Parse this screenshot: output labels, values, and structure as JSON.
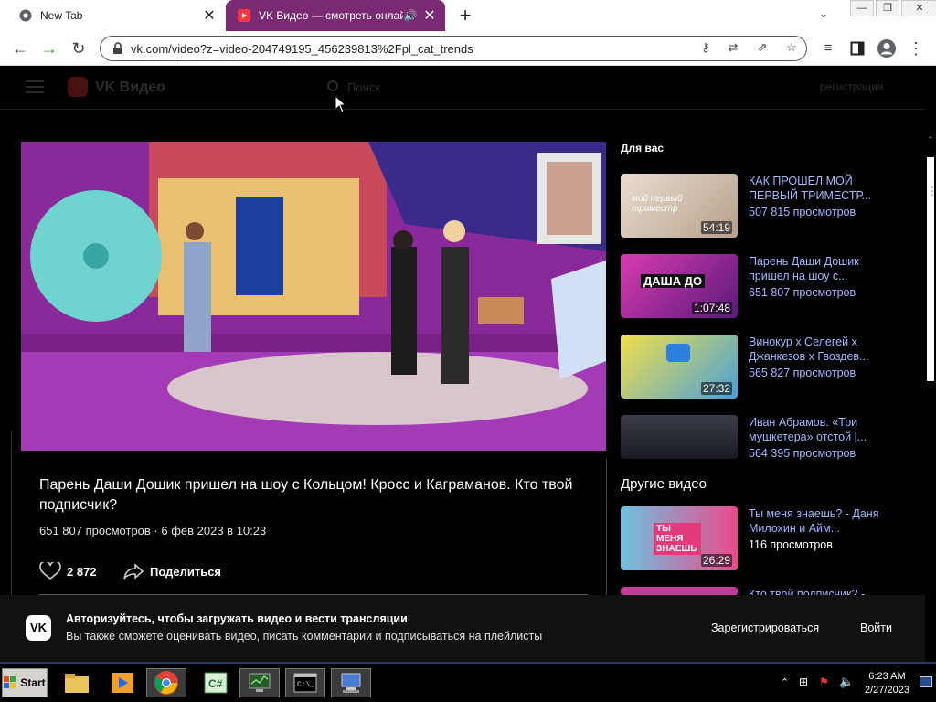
{
  "browser": {
    "tabs": [
      {
        "title": "New Tab",
        "active": false
      },
      {
        "title": "VK Видео — смотреть онлайн",
        "active": true
      }
    ],
    "url": "vk.com/video?z=video-204749195_456239813%2Fpl_cat_trends"
  },
  "header": {
    "brand": "VK Видео",
    "search_placeholder": "Поиск",
    "register": "регистрация"
  },
  "video": {
    "title": "Парень Даши Дошик пришел на шоу с Кольцом! Кросс и Каграманов. Кто твой подписчик?",
    "meta": "651 807 просмотров · 6 фев 2023 в 10:23",
    "likes": "2 872",
    "share_label": "Поделиться"
  },
  "sidebar": {
    "for_you_heading": "Для вас",
    "other_heading": "Другие видео",
    "cards": [
      {
        "title": "КАК ПРОШЕЛ МОЙ ПЕРВЫЙ ТРИМЕСТР...",
        "views": "507 815 просмотров",
        "duration": "54:19",
        "thumb_caption": "мой первый триместр"
      },
      {
        "title": "Парень Даши Дошик пришел на шоу с...",
        "views": "651 807 просмотров",
        "duration": "1:07:48",
        "thumb_caption": "ДАША ДО"
      },
      {
        "title": "Винокур x Селегей x Джанкезов x Гвоздев...",
        "views": "565 827 просмотров",
        "duration": "27:32",
        "thumb_caption": ""
      },
      {
        "title": "Иван Абрамов. «Три мушкетера» отстой |...",
        "views": "564 395 просмотров",
        "duration": "",
        "thumb_caption": ""
      },
      {
        "title": "Ты меня знаешь? - Даня Милохин и Айм...",
        "views": "116 просмотров",
        "duration": "26:29",
        "thumb_caption": "ТЫ МЕНЯ ЗНАЕШЬ"
      },
      {
        "title": "Кто твой подписчик? -",
        "views": "",
        "duration": "",
        "thumb_caption": ""
      }
    ]
  },
  "banner": {
    "badge": "VK",
    "title": "Авторизуйтесь, чтобы загружать видео и вести трансляции",
    "subtitle": "Вы также сможете оценивать видео, писать комментарии и подписываться на плейлисты",
    "register": "Зарегистрироваться",
    "login": "Войти"
  },
  "taskbar": {
    "start": "Start",
    "time": "6:23 AM",
    "date": "2/27/2023"
  },
  "colors": {
    "tab_active": "#7a2a73",
    "link": "#a3b8ff",
    "page_bg": "#000000"
  }
}
